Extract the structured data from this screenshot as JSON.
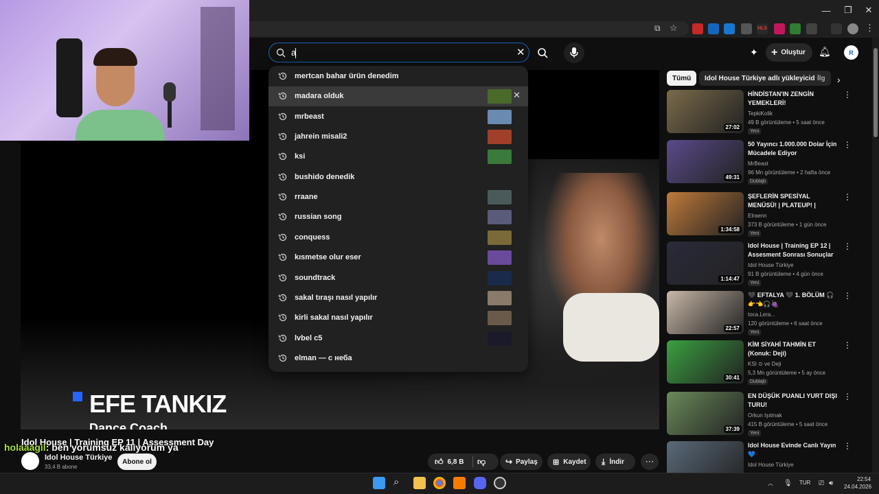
{
  "search": {
    "query": "a",
    "suggestions": [
      {
        "text": "mertcan bahar ürün denedim"
      },
      {
        "text": "madara olduk",
        "thumb": "#4a6a2a",
        "removable": true,
        "active": true
      },
      {
        "text": "mrbeast",
        "thumb": "#6a8ab0"
      },
      {
        "text": "jahrein misali2",
        "thumb": "#a0402a"
      },
      {
        "text": "ksi",
        "thumb": "#3a7a3a"
      },
      {
        "text": "bushido denedik"
      },
      {
        "text": "rraane",
        "thumb": "#4a5a5a"
      },
      {
        "text": "russian song",
        "thumb": "#5a5a7a"
      },
      {
        "text": "conquess",
        "thumb": "#7a6a3a"
      },
      {
        "text": "kısmetse olur eser",
        "thumb": "#6a4a9a"
      },
      {
        "text": "soundtrack",
        "thumb": "#1a2a4a"
      },
      {
        "text": "sakal tıraşı nasıl yapılır",
        "thumb": "#8a7a6a"
      },
      {
        "text": "kirli sakal nasıl yapılır",
        "thumb": "#6a5a4a"
      },
      {
        "text": "lvbel c5",
        "thumb": "#1a1a2a"
      },
      {
        "text": "elman — с неба"
      }
    ]
  },
  "header": {
    "create_label": "Oluştur",
    "avatar_letter": "R"
  },
  "player": {
    "lower_third_name": "EFE TANKIZ",
    "lower_third_role": "Dance Coach"
  },
  "video": {
    "title": "Idol House | Training EP 11 | Assessment Day",
    "channel": "Idol House Türkiye",
    "subscribers": "33,4 B abone",
    "subscribe_label": "Abone ol",
    "likes": "6,8 B",
    "share_label": "Paylaş",
    "save_label": "Kaydet",
    "download_label": "İndir"
  },
  "chat_overlay": {
    "user": "holaaagil",
    "message": ": ben yorumsuz kalıyorum ya"
  },
  "chips": [
    "Tümü",
    "Idol House Türkiye adlı yükleyiciden",
    "İlg"
  ],
  "recommendations": [
    {
      "title": "HİNDİSTAN'IN ZENGİN YEMEKLERİ!",
      "channel": "TepkiKolik",
      "meta": "49 B görüntüleme • 5 saat önce",
      "badge": "Yeni",
      "duration": "27:02",
      "thumb": "#7a6a4a"
    },
    {
      "title": "50 Yayıncı 1.000.000 Dolar İçin Mücadele Ediyor",
      "channel": "MrBeast",
      "meta": "96 Mn görüntüleme • 2 hafta önce",
      "badge": "Dublajlı",
      "duration": "49:31",
      "thumb": "#5a4a8a"
    },
    {
      "title": "ŞEFLERİN SPESİYAL MENÜSÜ! | PLATEUP! | MUTFAKTA KAOS",
      "channel": "Elraenn",
      "meta": "373 B görüntüleme • 1 gün önce",
      "badge": "Yeni",
      "duration": "1:34:58",
      "thumb": "#c07a3a"
    },
    {
      "title": "Idol House | Training EP 12 | Assesment Sonrası Sonuçlar ...",
      "channel": "Idol House Türkiye",
      "meta": "91 B görüntüleme • 4 gün önce",
      "badge": "Yeni",
      "duration": "1:14:47",
      "thumb": "#2a2a3a"
    },
    {
      "title": "🖤 EFTALYA 🖤 1. BÖLÜM 🎧 👉👈🎧🍇",
      "channel": "toca.Lera...",
      "meta": "120 görüntüleme • 6 saat önce",
      "badge": "Yeni",
      "duration": "22:57",
      "thumb": "#c8b8a8"
    },
    {
      "title": "KİM SİYAHİ TAHMİN ET (Konuk: Deji)",
      "channel": "KSI ⊙ ve Deji",
      "meta": "5,3 Mn görüntüleme • 5 ay önce",
      "badge": "Dublajlı",
      "duration": "30:41",
      "thumb": "#3aa040"
    },
    {
      "title": "EN DÜŞÜK PUANLI YURT DIŞI TURU!",
      "channel": "Orkun Işıtmak",
      "meta": "415 B görüntüleme • 5 saat önce",
      "badge": "Yeni",
      "duration": "37:39",
      "thumb": "#6a8a5a"
    },
    {
      "title": "Idol House Evinde Canlı Yayın 💙",
      "channel": "Idol House Türkiye",
      "meta": "",
      "badge": "",
      "duration": "",
      "thumb": "#5a6a7a"
    }
  ],
  "taskbar": {
    "language": "TUR",
    "time": "22:54",
    "date": "24.04.2026"
  },
  "colors": {
    "accent_blue": "#1c62b9",
    "youtube_bg": "#0f0f0f",
    "chat_user": "#a6e13a",
    "lower_third_square": "#2764ff"
  }
}
